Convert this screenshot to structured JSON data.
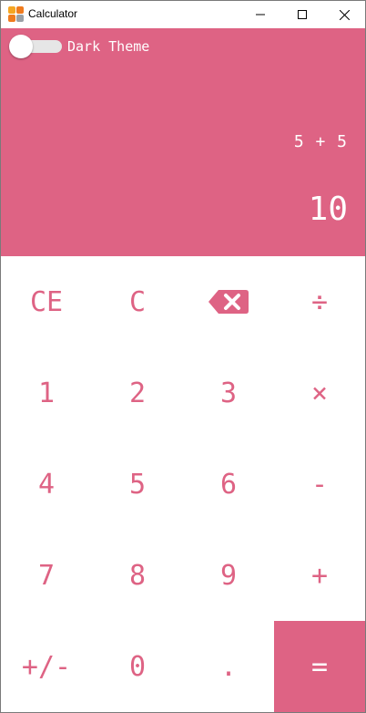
{
  "window": {
    "title": "Calculator",
    "controls": [
      "minimize-icon",
      "maximize-icon",
      "close-icon"
    ]
  },
  "theme": {
    "accent": "#de6384",
    "key_background": "#ffffff",
    "text_on_accent": "#ffffff"
  },
  "toggle": {
    "label": "Dark Theme",
    "on": false
  },
  "display": {
    "expression": "5 + 5",
    "result": "10"
  },
  "keys": {
    "ce": "CE",
    "c": "C",
    "backspace": "backspace-icon",
    "divide": "÷",
    "one": "1",
    "two": "2",
    "three": "3",
    "multiply": "×",
    "four": "4",
    "five": "5",
    "six": "6",
    "minus": "-",
    "seven": "7",
    "eight": "8",
    "nine": "9",
    "plus": "+",
    "negate": "+/-",
    "zero": "0",
    "decimal": ".",
    "equals": "="
  }
}
